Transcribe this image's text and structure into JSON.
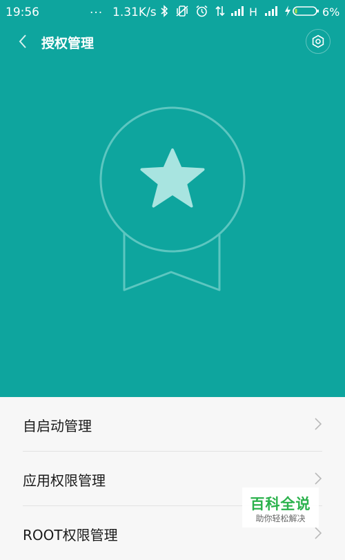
{
  "status_bar": {
    "time": "19:56",
    "more": "...",
    "net_speed": "1.31K/s",
    "network_type": "H",
    "battery": "6%",
    "icons": [
      "bluetooth-icon",
      "vibrate-icon",
      "alarm-icon",
      "data-arrows-icon",
      "signal-icon",
      "signal-icon",
      "charging-icon",
      "battery-icon"
    ]
  },
  "header": {
    "title": "授权管理",
    "back_icon": "chevron-left-icon",
    "settings_icon": "gear-icon"
  },
  "hero": {
    "background_color": "#0ea59e",
    "illustration": "medal-star-icon"
  },
  "menu": {
    "items": [
      {
        "label": "自启动管理"
      },
      {
        "label": "应用权限管理"
      },
      {
        "label": "ROOT权限管理"
      }
    ]
  },
  "watermark": {
    "title": "百科全说",
    "subtitle": "助你轻松解决"
  }
}
